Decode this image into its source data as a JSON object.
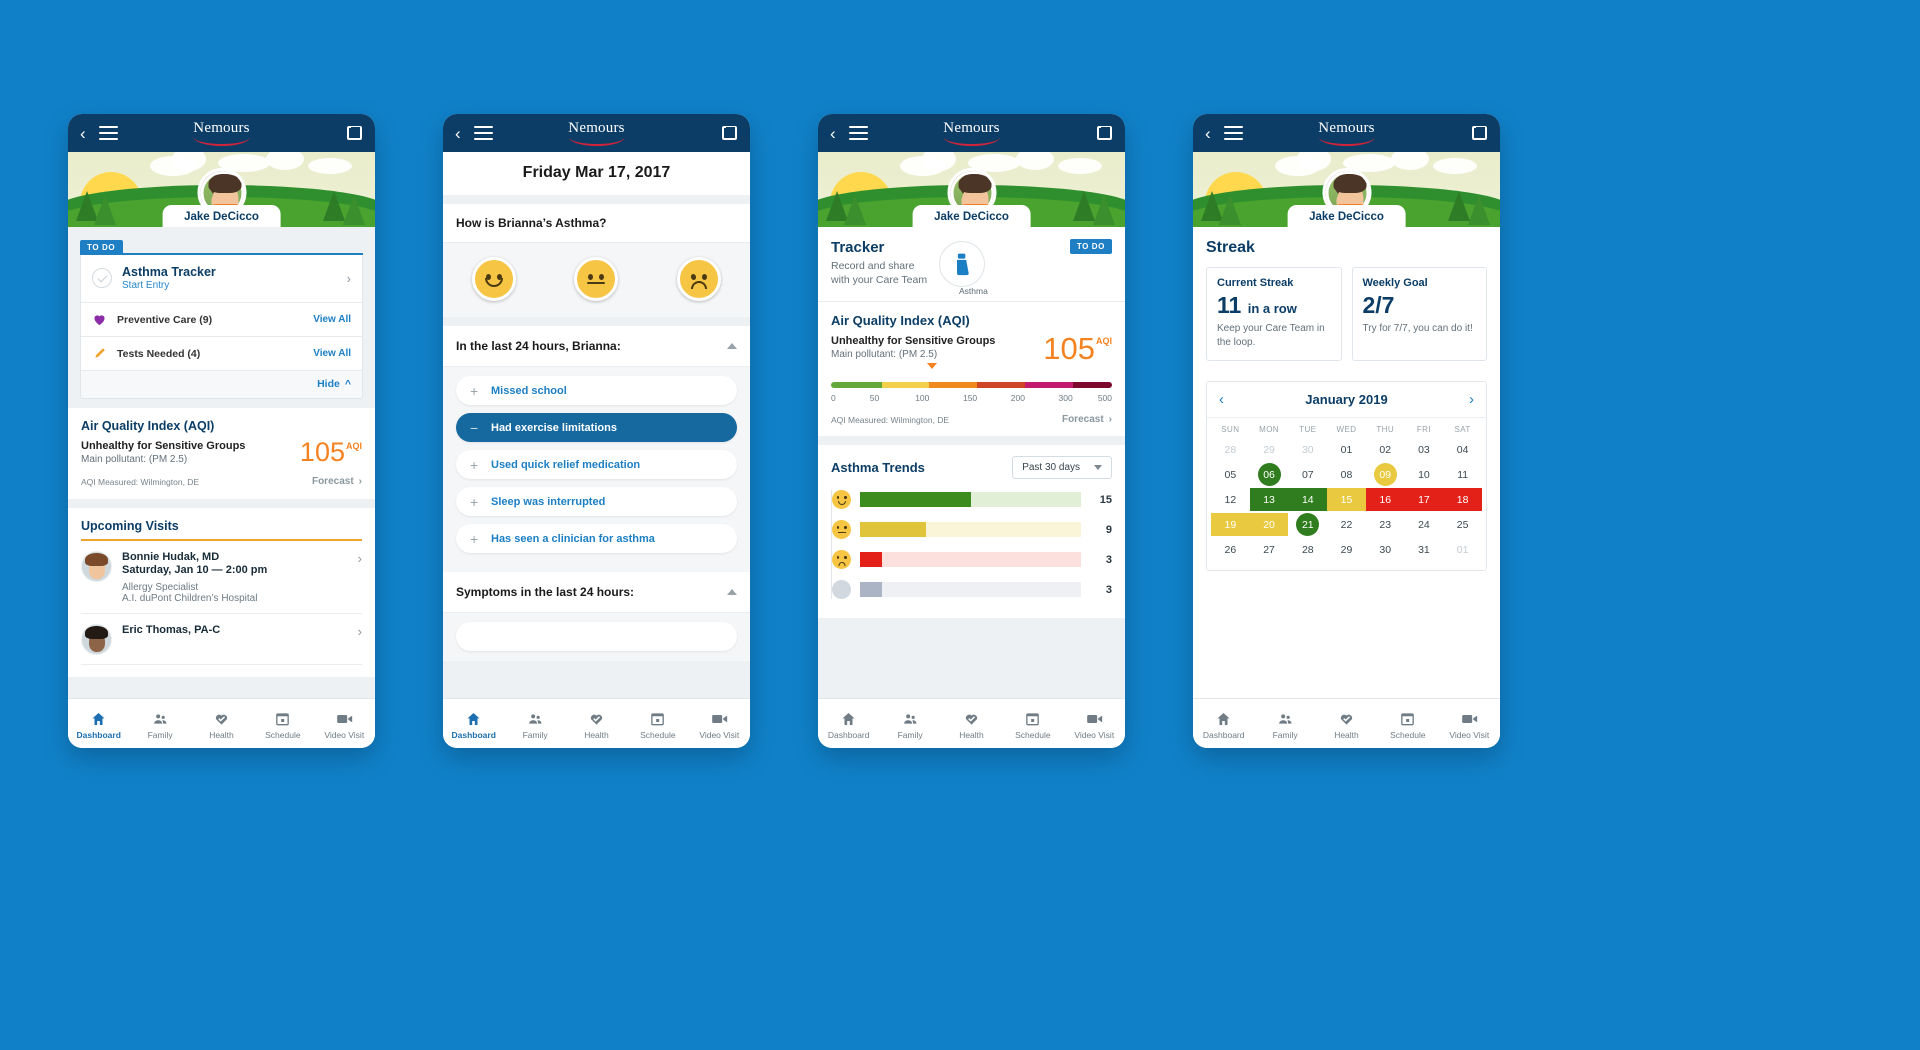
{
  "brand": {
    "wordmark": "Nemours",
    "accent_red": "#d1243b",
    "navy": "#0b3d66",
    "blue": "#1f7fc4",
    "orange": "#f58220"
  },
  "tabbar": {
    "items": [
      {
        "label": "Dashboard",
        "icon": "home-icon",
        "active": true
      },
      {
        "label": "Family",
        "icon": "people-icon",
        "active": false
      },
      {
        "label": "Health",
        "icon": "heart-check-icon",
        "active": false
      },
      {
        "label": "Schedule",
        "icon": "calendar-icon",
        "active": false
      },
      {
        "label": "Video Visit",
        "icon": "video-camera-icon",
        "active": false
      }
    ]
  },
  "phone1": {
    "patient_name": "Jake DeCicco",
    "todo": {
      "tab_label": "TO DO",
      "tracker_title": "Asthma Tracker",
      "tracker_sub": "Start Entry",
      "rows": [
        {
          "label": "Preventive Care (9)",
          "action": "View All",
          "icon": "heart-icon"
        },
        {
          "label": "Tests Needed (4)",
          "action": "View All",
          "icon": "test-tube-icon"
        }
      ],
      "hide_label": "Hide"
    },
    "aqi": {
      "title": "Air Quality Index (AQI)",
      "status": "Unhealthy for Sensitive Groups",
      "pollutant": "Main pollutant: (PM 2.5)",
      "value": "105",
      "unit": "AQI",
      "measured": "AQI Measured: Wilmington, DE",
      "forecast": "Forecast"
    },
    "visits": {
      "title": "Upcoming Visits",
      "items": [
        {
          "name": "Bonnie Hudak, MD",
          "when": "Saturday, Jan 10 — 2:00 pm",
          "specialty": "Allergy Specialist",
          "location": "A.I. duPont Children’s Hospital"
        },
        {
          "name": "Eric Thomas, PA-C",
          "when": "",
          "specialty": "",
          "location": ""
        }
      ]
    }
  },
  "phone2": {
    "date": "Friday Mar 17, 2017",
    "question": "How is Brianna’s Asthma?",
    "faces": [
      {
        "name": "happy-face",
        "state": "smile"
      },
      {
        "name": "neutral-face",
        "state": "flat"
      },
      {
        "name": "sad-face",
        "state": "frown"
      }
    ],
    "last24": {
      "heading": "In the last 24 hours, Brianna:",
      "items": [
        {
          "label": "Missed school",
          "selected": false,
          "sign": "+"
        },
        {
          "label": "Had exercise limitations",
          "selected": true,
          "sign": "−"
        },
        {
          "label": "Used quick relief medication",
          "selected": false,
          "sign": "+"
        },
        {
          "label": "Sleep was interrupted",
          "selected": false,
          "sign": "+"
        },
        {
          "label": "Has seen a clinician for asthma",
          "selected": false,
          "sign": "+"
        }
      ]
    },
    "symptoms_heading": "Symptoms in the last 24 hours:"
  },
  "phone3": {
    "patient_name": "Jake DeCicco",
    "tracker": {
      "title": "Tracker",
      "subtitle": "Record and share\nwith your Care Team",
      "icon_label": "Asthma",
      "badge": "TO DO"
    },
    "aqi": {
      "title": "Air Quality Index (AQI)",
      "status": "Unhealthy for Sensitive Groups",
      "pollutant": "Main pollutant: (PM 2.5)",
      "value": "105",
      "unit": "AQI",
      "measured": "AQI Measured: Wilmington, DE",
      "forecast": "Forecast",
      "scale_ticks": [
        "0",
        "50",
        "100",
        "150",
        "200",
        "300",
        "500"
      ],
      "marker_value": 105
    },
    "trends": {
      "title": "Asthma Trends",
      "range": "Past 30 days"
    },
    "chart_data": {
      "type": "bar",
      "title": "Asthma Trends",
      "subtitle": "Past 30 days",
      "orientation": "horizontal",
      "categories": [
        "Good (happy)",
        "Fair (neutral)",
        "Poor (sad)",
        "Unrecorded"
      ],
      "values": [
        15,
        9,
        3,
        3
      ],
      "value_labels": [
        "15",
        "9",
        "3",
        "3"
      ],
      "colors": [
        "#3d8c1f",
        "#e0c43c",
        "#e32119",
        "#aab4c4"
      ],
      "track_colors": [
        "#e1efd7",
        "#faf4d8",
        "#fbe0de",
        "#e7eaf0"
      ],
      "max": 30,
      "xlabel": "",
      "ylabel": "",
      "grid": false,
      "legend": false
    }
  },
  "phone4": {
    "patient_name": "Jake DeCicco",
    "title": "Streak",
    "cards": [
      {
        "title": "Current Streak",
        "value": "11",
        "value_suffix": "in a row",
        "desc": "Keep your Care Team in the loop."
      },
      {
        "title": "Weekly Goal",
        "value": "2/7",
        "value_suffix": "",
        "desc": "Try for 7/7, you can do it!"
      }
    ],
    "calendar": {
      "month": "January 2019",
      "prev_icon": "chevron-left-icon",
      "next_icon": "chevron-right-icon",
      "dow": [
        "SUN",
        "MON",
        "TUE",
        "WED",
        "THU",
        "FRI",
        "SAT"
      ],
      "weeks": [
        [
          {
            "d": "28",
            "mut": true,
            "style": "none"
          },
          {
            "d": "29",
            "mut": true,
            "style": "none"
          },
          {
            "d": "30",
            "mut": true,
            "style": "none"
          },
          {
            "d": "01",
            "mut": false,
            "style": "none"
          },
          {
            "d": "02",
            "mut": false,
            "style": "none"
          },
          {
            "d": "03",
            "mut": false,
            "style": "none"
          },
          {
            "d": "04",
            "mut": false,
            "style": "none"
          }
        ],
        [
          {
            "d": "05",
            "mut": false,
            "style": "none"
          },
          {
            "d": "06",
            "mut": false,
            "style": "dot-green"
          },
          {
            "d": "07",
            "mut": false,
            "style": "none"
          },
          {
            "d": "08",
            "mut": false,
            "style": "none"
          },
          {
            "d": "09",
            "mut": false,
            "style": "dot-yellow"
          },
          {
            "d": "10",
            "mut": false,
            "style": "none"
          },
          {
            "d": "11",
            "mut": false,
            "style": "none"
          }
        ],
        [
          {
            "d": "12",
            "mut": false,
            "style": "none"
          },
          {
            "d": "13",
            "mut": false,
            "style": "block-green"
          },
          {
            "d": "14",
            "mut": false,
            "style": "block-green"
          },
          {
            "d": "15",
            "mut": false,
            "style": "block-yellow"
          },
          {
            "d": "16",
            "mut": false,
            "style": "block-red"
          },
          {
            "d": "17",
            "mut": false,
            "style": "block-red"
          },
          {
            "d": "18",
            "mut": false,
            "style": "block-red"
          }
        ],
        [
          {
            "d": "19",
            "mut": false,
            "style": "block-yellow"
          },
          {
            "d": "20",
            "mut": false,
            "style": "block-yellow"
          },
          {
            "d": "21",
            "mut": false,
            "style": "dot-green-dark"
          },
          {
            "d": "22",
            "mut": false,
            "style": "none"
          },
          {
            "d": "23",
            "mut": false,
            "style": "none"
          },
          {
            "d": "24",
            "mut": false,
            "style": "none"
          },
          {
            "d": "25",
            "mut": false,
            "style": "none"
          }
        ],
        [
          {
            "d": "26",
            "mut": false,
            "style": "none"
          },
          {
            "d": "27",
            "mut": false,
            "style": "none"
          },
          {
            "d": "28",
            "mut": false,
            "style": "none"
          },
          {
            "d": "29",
            "mut": false,
            "style": "none"
          },
          {
            "d": "30",
            "mut": false,
            "style": "none"
          },
          {
            "d": "31",
            "mut": false,
            "style": "none"
          },
          {
            "d": "01",
            "mut": true,
            "style": "none"
          }
        ]
      ]
    }
  }
}
